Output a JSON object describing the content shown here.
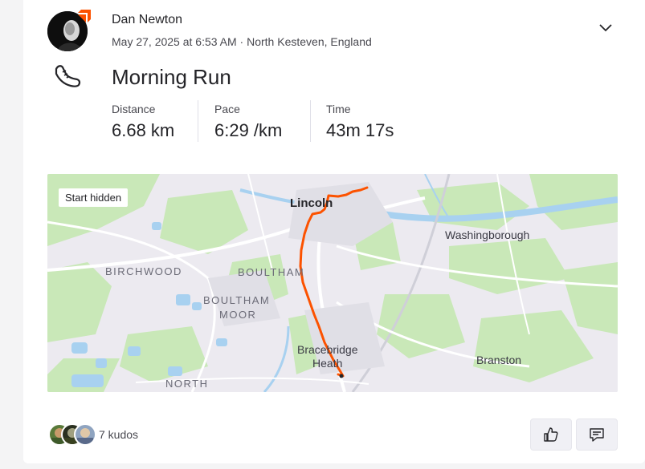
{
  "activity": {
    "athlete_name": "Dan Newton",
    "date_time": "May 27, 2025 at 6:53 AM",
    "separator": " · ",
    "location": "North Kesteven, England",
    "title": "Morning Run",
    "sport_icon": "running-shoe-icon",
    "stats": [
      {
        "label": "Distance",
        "value": "6.68 km"
      },
      {
        "label": "Pace",
        "value": "6:29 /km"
      },
      {
        "label": "Time",
        "value": "43m 17s"
      }
    ]
  },
  "map": {
    "privacy_label": "Start hidden",
    "route_color": "#fc5200",
    "places": {
      "lincoln": "Lincoln",
      "washingborough": "Washingborough",
      "birchwood": "BIRCHWOOD",
      "boultham": "BOULTHAM",
      "boultham_moor_1": "BOULTHAM",
      "boultham_moor_2": "MOOR",
      "bracebridge_1": "Bracebridge",
      "bracebridge_2": "Heath",
      "branston": "Branston",
      "north": "NORTH"
    }
  },
  "social": {
    "kudos_text": "7 kudos",
    "kudos_icon": "thumbs-up-icon",
    "comment_icon": "comment-icon"
  },
  "colors": {
    "brand": "#fc5200",
    "map_green": "#c6e7b4",
    "map_water": "#a8d1f0"
  }
}
